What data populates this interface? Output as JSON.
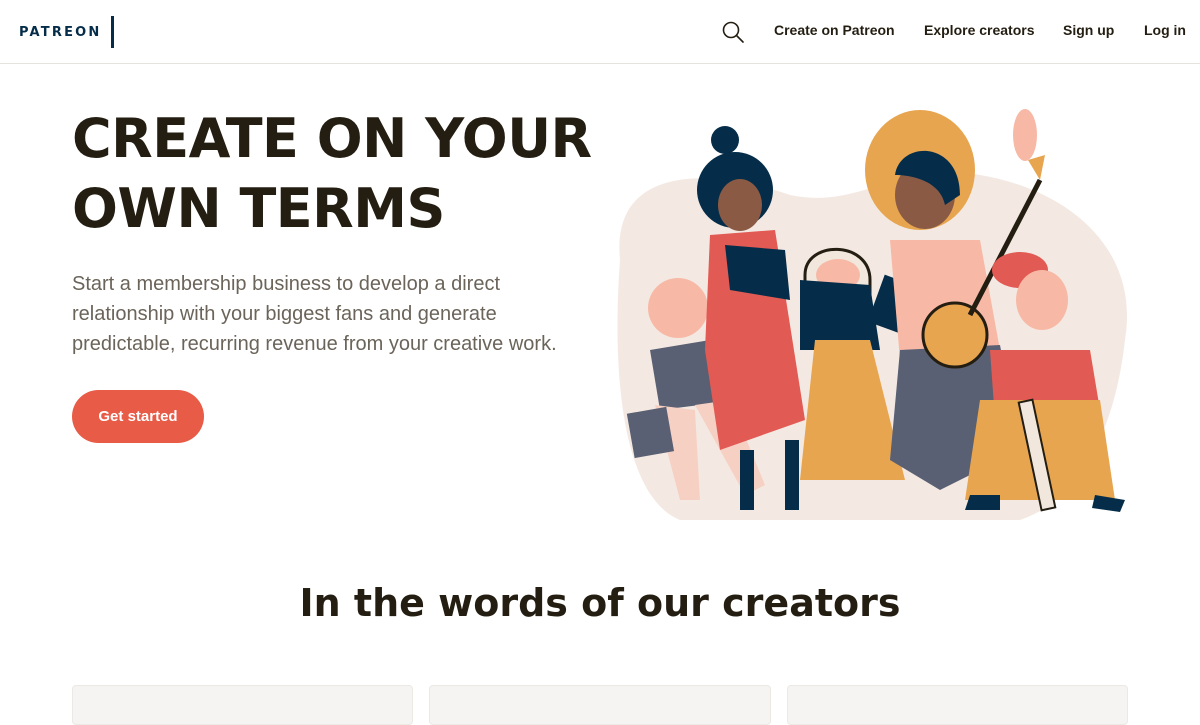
{
  "header": {
    "logo_text": "PATREON",
    "nav": {
      "create": "Create on Patreon",
      "explore": "Explore creators",
      "signup": "Sign up",
      "login": "Log in"
    }
  },
  "hero": {
    "title_line1": "CREATE ON YOUR",
    "title_line2": "OWN TERMS",
    "subtitle": "Start a membership business to develop a direct relationship with your biggest fans and generate predictable, recurring revenue from your creative work.",
    "cta_label": "Get started"
  },
  "testimonials": {
    "title": "In the words of our creators"
  },
  "colors": {
    "brand_navy": "#052d49",
    "cta_coral": "#e85b46",
    "text_dark": "#241e12",
    "text_muted": "#6b645a"
  },
  "icons": {
    "search": "search-icon"
  }
}
